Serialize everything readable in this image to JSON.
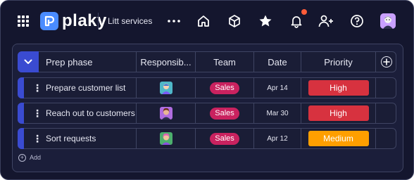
{
  "topbar": {
    "brand": "plaky",
    "workspace": "Litt services",
    "icons": [
      "apps-grid-icon",
      "logo-icon",
      "more-icon",
      "home-icon",
      "box-icon",
      "star-icon",
      "bell-icon",
      "add-user-icon",
      "help-icon",
      "avatar"
    ]
  },
  "board": {
    "columns": {
      "name": "Prep phase",
      "responsible": "Responsib...",
      "team": "Team",
      "date": "Date",
      "priority": "Priority"
    },
    "rows": [
      {
        "name": "Prepare customer list",
        "team": "Sales",
        "date": "Apr 14",
        "priority": "High"
      },
      {
        "name": "Reach out to customers",
        "team": "Sales",
        "date": "Mar 30",
        "priority": "High"
      },
      {
        "name": "Sort requests",
        "team": "Sales",
        "date": "Apr 12",
        "priority": "Medium"
      }
    ],
    "add_label": "Add"
  },
  "colors": {
    "background": "#14162e",
    "accent": "#3a4bd1",
    "sales": "#c9225f",
    "high": "#d7323f",
    "medium": "#ff9f00",
    "notification": "#ff5c39"
  }
}
